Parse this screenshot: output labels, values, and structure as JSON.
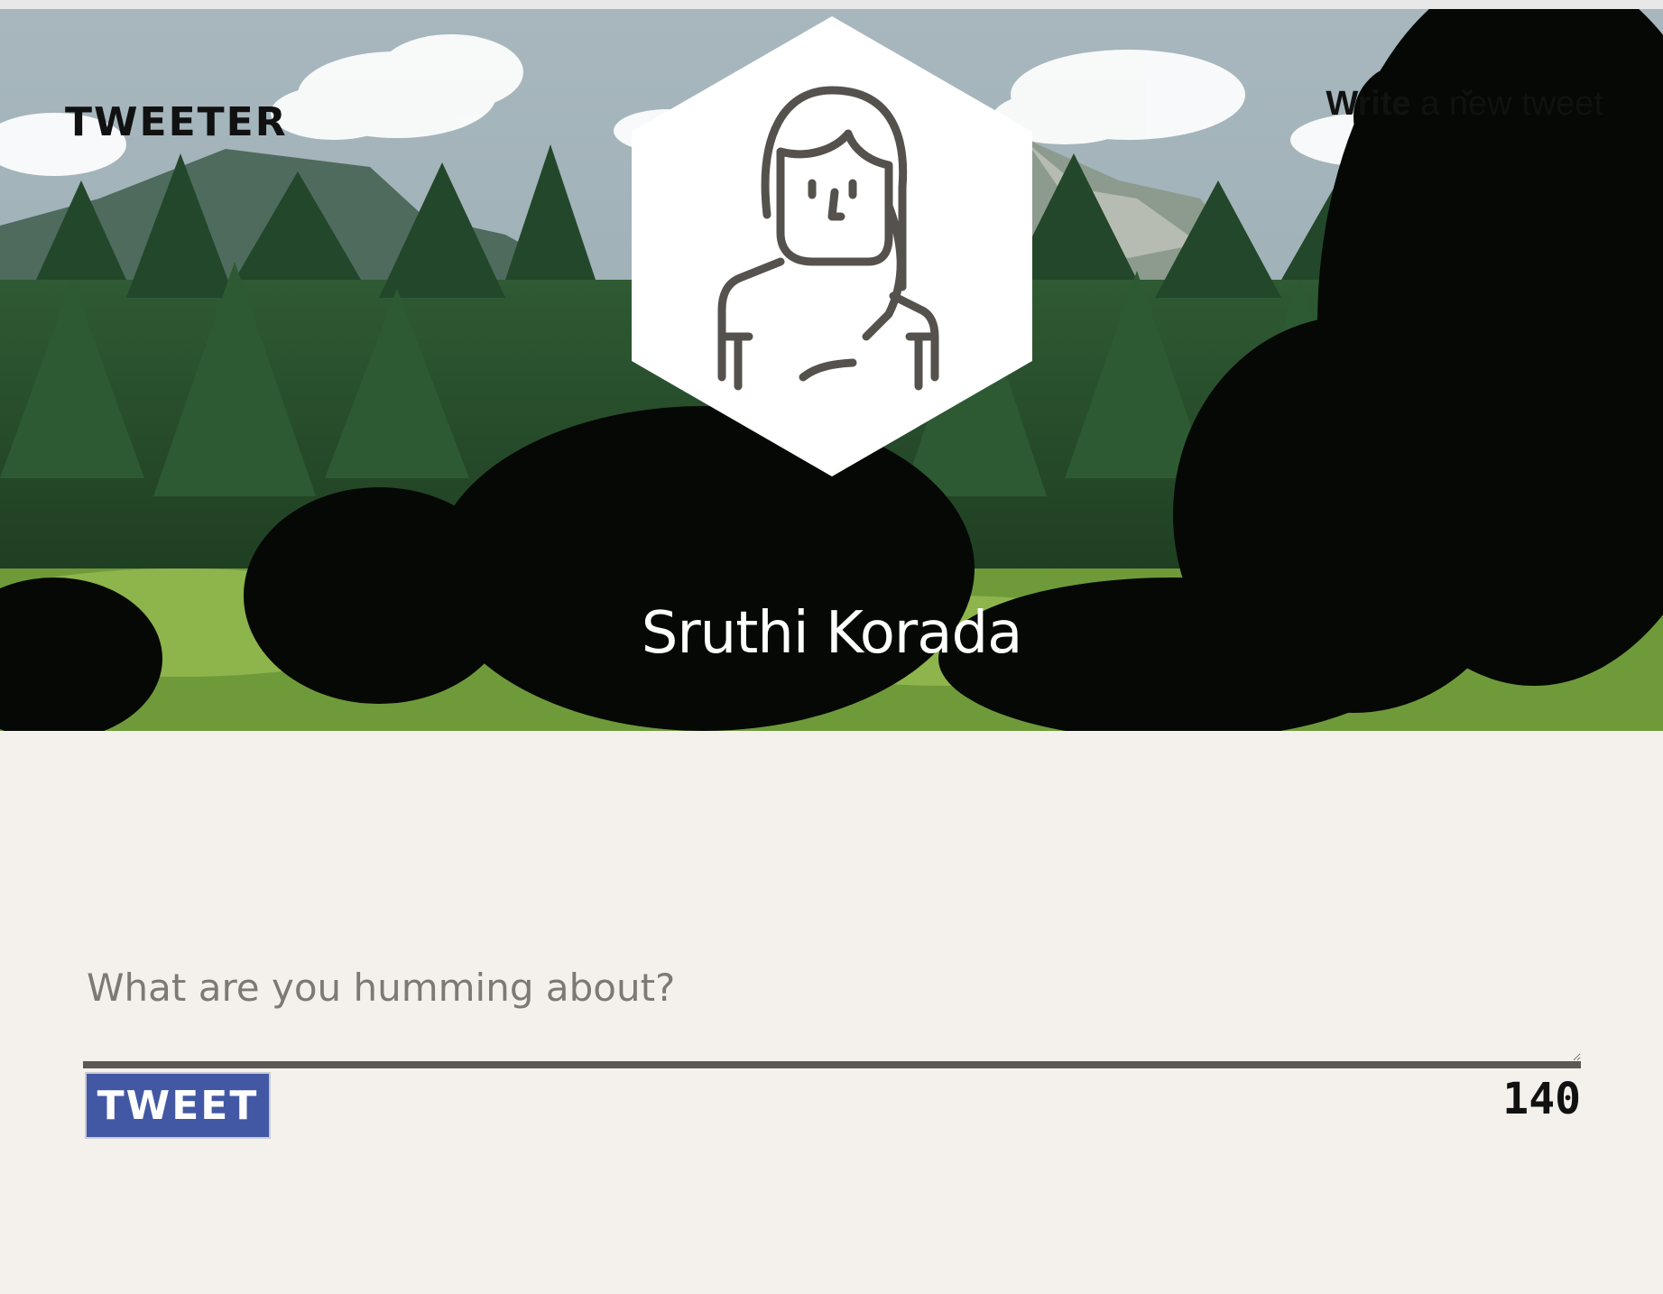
{
  "header": {
    "brand": "TWEETER",
    "nav_toggle": {
      "bold": "Write",
      "rest": " a new tweet",
      "icon": "chevron-down-icon"
    },
    "profile_name": "Sruthi Korada",
    "avatar_icon": "female-avatar-icon"
  },
  "compose": {
    "placeholder": "What are you humming about?",
    "value": "",
    "button_label": "TWEET",
    "counter": "140"
  },
  "colors": {
    "page_background": "#f4f1ec",
    "button": "#4258a4",
    "divider": "#5c5955"
  }
}
